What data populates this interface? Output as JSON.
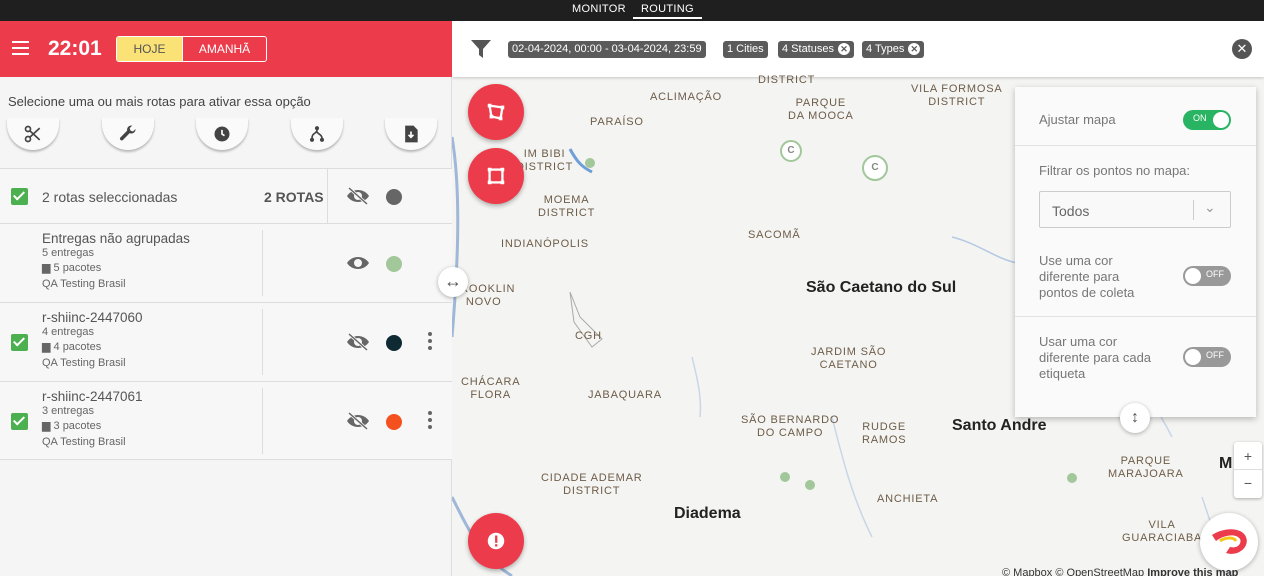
{
  "topnav": {
    "tabs": [
      {
        "label": "MONITOR"
      },
      {
        "label": "ROUTING"
      }
    ]
  },
  "header": {
    "time": "22:01",
    "today": "HOJE",
    "tomorrow": "AMANHÃ"
  },
  "hint": "Selecione uma ou mais rotas para ativar essa opção",
  "tools": [
    "scissors-icon",
    "wrench-icon",
    "clock-icon",
    "route-icon",
    "download-icon"
  ],
  "summary": {
    "selected": "2 rotas seleccionadas",
    "count": "2 ROTAS"
  },
  "routes": [
    {
      "title": "Entregas não agrupadas",
      "deliveries": "5 entregas",
      "packages": "5 pacotes",
      "company": "QA Testing Brasil",
      "color": "#a2c79a"
    },
    {
      "title": "r-shiinc-2447060",
      "deliveries": "4 entregas",
      "packages": "4 pacotes",
      "company": "QA Testing Brasil",
      "color": "#0f2a33"
    },
    {
      "title": "r-shiinc-2447061",
      "deliveries": "3 entregas",
      "packages": "3 pacotes",
      "company": "QA Testing Brasil",
      "color": "#f4511e"
    }
  ],
  "filters": {
    "date": "02-04-2024, 00:00 - 03-04-2024, 23:59",
    "cities": "1 Cities",
    "statuses": "4 Statuses",
    "types": "4 Types"
  },
  "map": {
    "labels": {
      "district1": "DISTRICT",
      "aclimacao": "ACLIMAÇÃO",
      "parque_mooca": "PARQUE\nDA MOOCA",
      "vila_formosa": "VILA FORMOSA\nDISTRICT",
      "paraiso": "PARAÍSO",
      "ibirapuera": "IM BIBI\nDISTRICT",
      "moema": "MOEMA\nDISTRICT",
      "indianopolis": "INDIANÓPOLIS",
      "sacoma": "SACOMÃ",
      "brooklin": "BROOKLIN\nNOVO",
      "cgh": "CGH",
      "jardim_sao_caetano": "JARDIM SÃO\nCAETANO",
      "chacara_flora": "CHÁCARA\nFLORA",
      "jabaquara": "JABAQUARA",
      "sao_bernardo": "SÃO BERNARDO\nDO CAMPO",
      "rudge_ramos": "RUDGE\nRAMOS",
      "cidade_ademar": "CIDADE ADEMAR\nDISTRICT",
      "anchieta": "ANCHIETA",
      "parque_marajoara": "PARQUE\nMARAJOARA",
      "vila_guaraciaba": "VILA\nGUARACIABA",
      "sao_caetano": "São Caetano do Sul",
      "santo_andre": "Santo Andre",
      "diadema": "Diadema",
      "m": "M"
    },
    "attribution": "© Mapbox © OpenStreetMap",
    "improve": "Improve this map"
  },
  "options": {
    "fit_map": "Ajustar mapa",
    "fit_map_state": "ON",
    "filter_points": "Filtrar os pontos no mapa:",
    "filter_value": "Todos",
    "collect_color": "Use uma cor\ndiferente para\npontos de coleta",
    "collect_state": "OFF",
    "label_color": "Usar uma cor\ndiferente para cada\netiqueta",
    "label_state": "OFF"
  },
  "zoom": {
    "in": "+",
    "out": "−"
  }
}
